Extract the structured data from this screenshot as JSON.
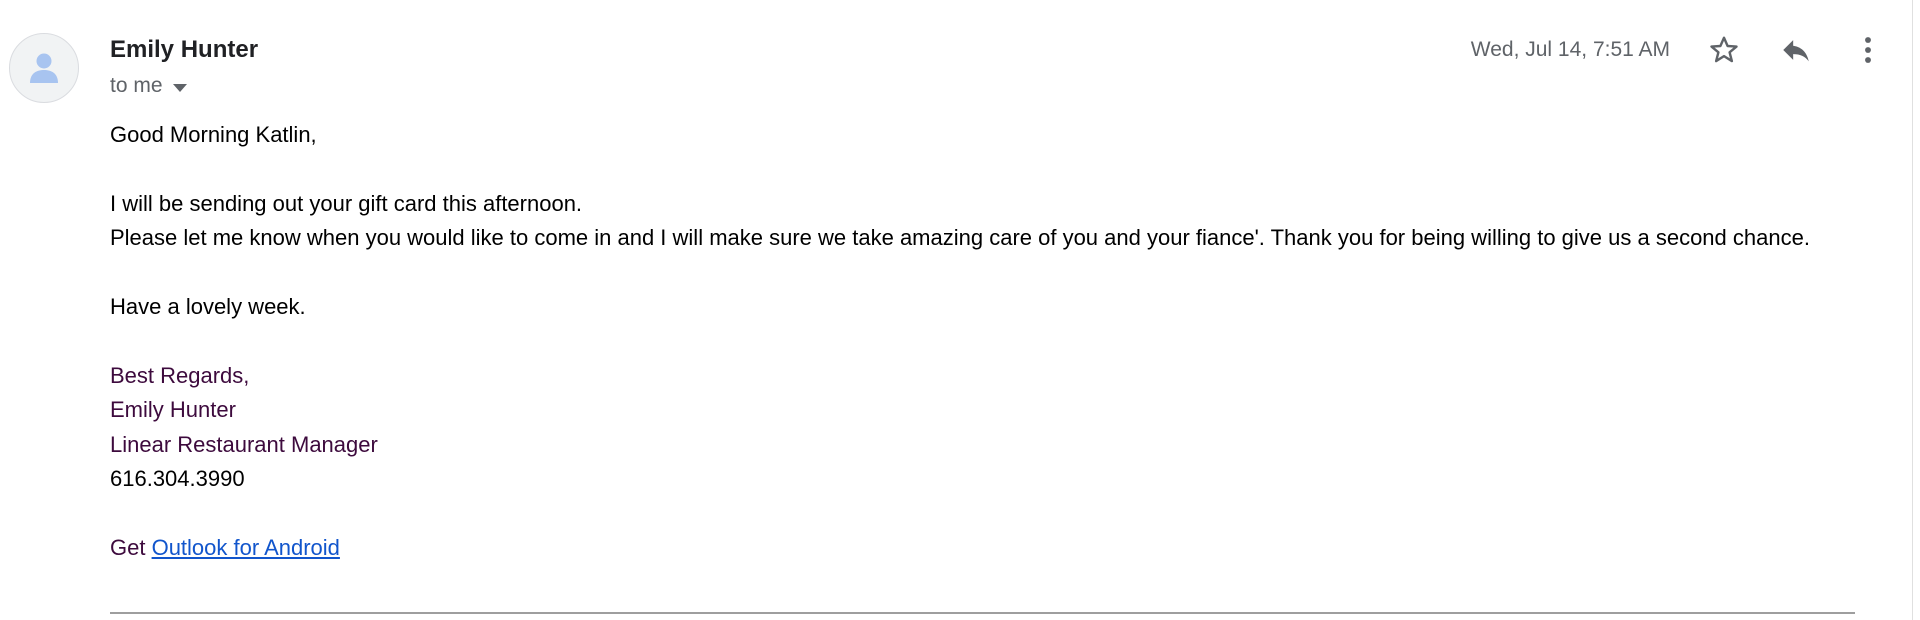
{
  "email": {
    "sender": "Emily Hunter",
    "recipient_label": "to me",
    "timestamp": "Wed, Jul 14, 7:51 AM",
    "icons": {
      "avatar": "person-icon",
      "star": "star-icon",
      "reply": "reply-icon",
      "more": "more-vert-icon",
      "recipient_toggle": "caret-down-icon"
    },
    "body": {
      "greeting": "Good Morning Katlin,",
      "line1": "I will be sending out your gift card this afternoon.",
      "line2": "Please let me know when you would like to come in and I will make sure we take amazing care of you and your fiance'.  Thank you for being willing to give us a second chance.",
      "closing": "Have a lovely week.",
      "signature": {
        "regards": "Best Regards,",
        "name": "Emily Hunter",
        "title": "Linear Restaurant Manager",
        "phone": "616.304.3990"
      },
      "footer": {
        "prefix": "Get ",
        "link_text": "Outlook for Android"
      }
    },
    "colors": {
      "signature": "#3d0a3d",
      "link": "#1155cc",
      "meta_text": "#5f6368",
      "avatar_icon": "#a8c4f0"
    }
  }
}
